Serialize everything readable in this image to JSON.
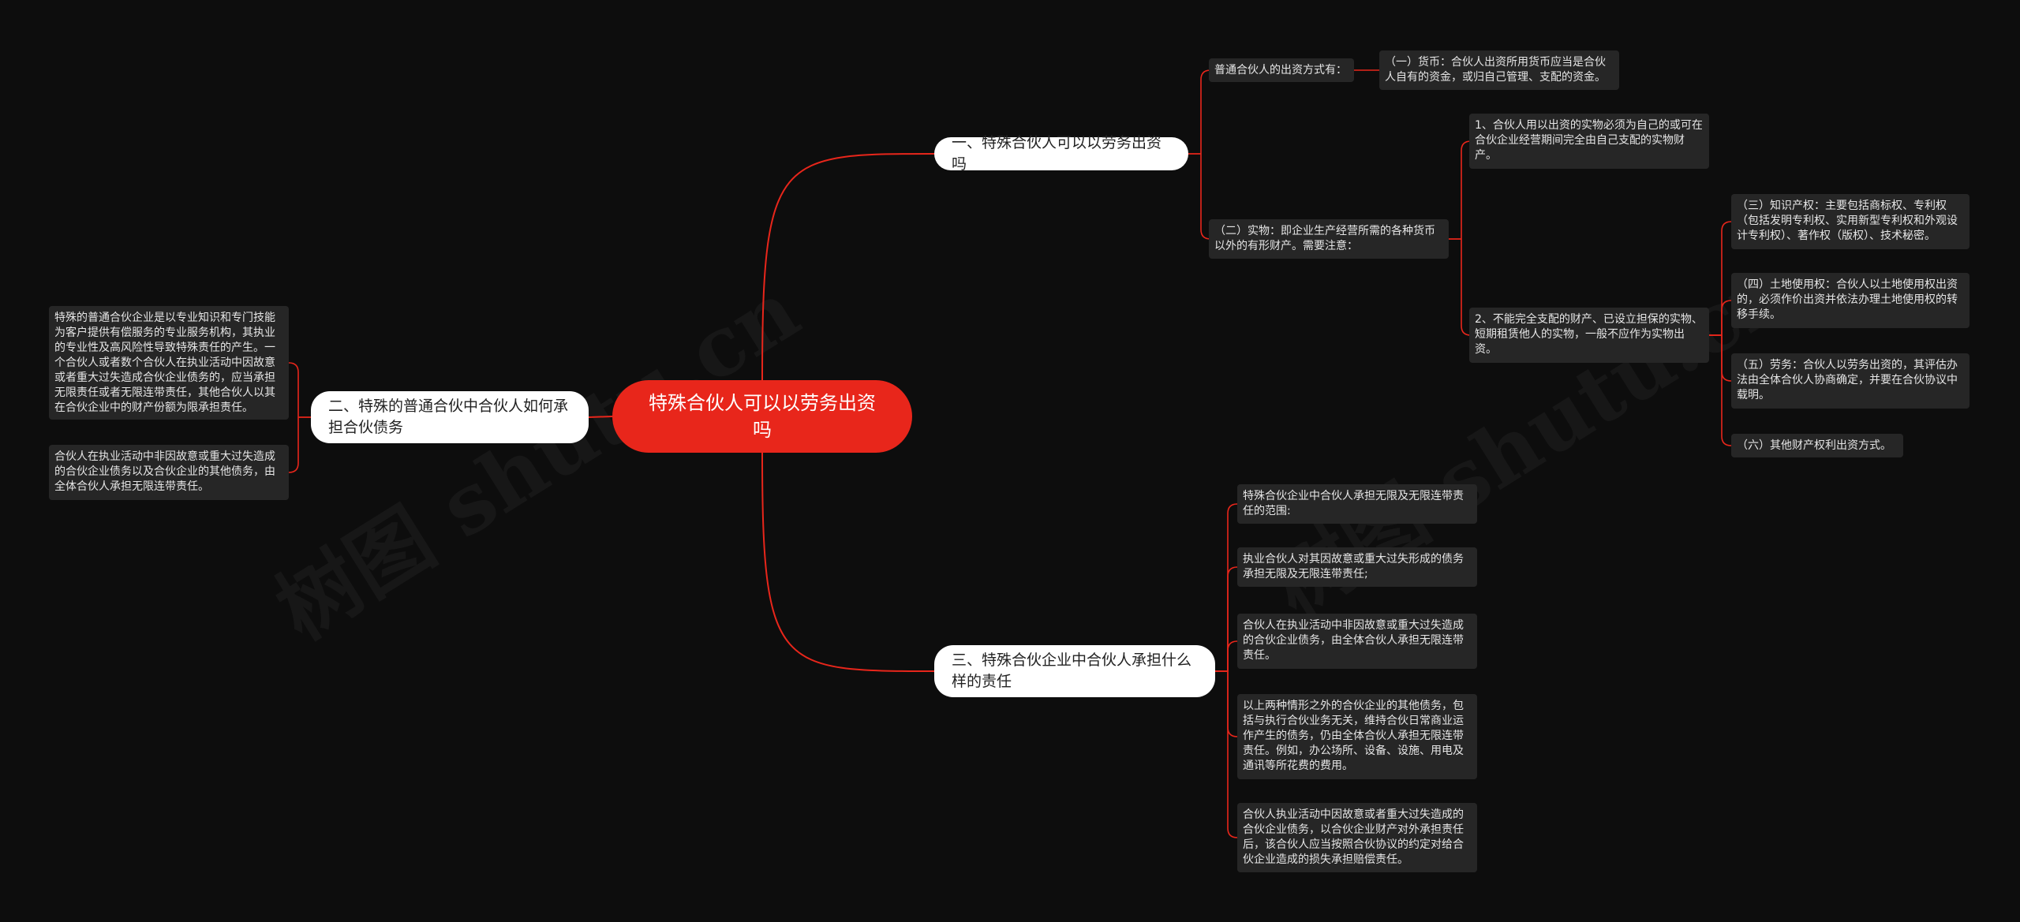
{
  "root": {
    "label": "特殊合伙人可以以劳务出资吗"
  },
  "branches": {
    "b1": {
      "label": "一、特殊合伙人可以以劳务出资吗"
    },
    "b2": {
      "label": "二、特殊的普通合伙中合伙人如何承担合伙债务"
    },
    "b3": {
      "label": "三、特殊合伙企业中合伙人承担什么样的责任"
    }
  },
  "leaves": {
    "b1_methods": "普通合伙人的出资方式有：",
    "b1_currency": "（一）货币：合伙人出资所用货币应当是合伙人自有的资金，或归自己管理、支配的资金。",
    "b1_goods": "（二）实物：即企业生产经营所需的各种货币以外的有形财产。需要注意：",
    "b1_goods_1": "1、合伙人用以出资的实物必须为自己的或可在合伙企业经营期间完全由自己支配的实物财产。",
    "b1_goods_2": "2、不能完全支配的财产、已设立担保的实物、短期租赁他人的实物，一般不应作为实物出资。",
    "b1_ip": "（三）知识产权：主要包括商标权、专利权（包括发明专利权、实用新型专利权和外观设计专利权）、著作权（版权）、技术秘密。",
    "b1_land": "（四）土地使用权：合伙人以土地使用权出资的，必须作价出资并依法办理土地使用权的转移手续。",
    "b1_labor": "（五）劳务：合伙人以劳务出资的，其评估办法由全体合伙人协商确定，并要在合伙协议中载明。",
    "b1_other": "（六）其他财产权利出资方式。",
    "b2_1": "特殊的普通合伙企业是以专业知识和专门技能为客户提供有偿服务的专业服务机构，其执业的专业性及高风险性导致特殊责任的产生。一个合伙人或者数个合伙人在执业活动中因故意或者重大过失造成合伙企业债务的，应当承担无限责任或者无限连带责任，其他合伙人以其在合伙企业中的财产份额为限承担责任。",
    "b2_2": "合伙人在执业活动中非因故意或重大过失造成的合伙企业债务以及合伙企业的其他债务，由全体合伙人承担无限连带责任。",
    "b3_1": "特殊合伙企业中合伙人承担无限及无限连带责任的范围:",
    "b3_2": "执业合伙人对其因故意或重大过失形成的债务承担无限及无限连带责任;",
    "b3_3": "合伙人在执业活动中非因故意或重大过失造成的合伙企业债务，由全体合伙人承担无限连带责任。",
    "b3_4": "以上两种情形之外的合伙企业的其他债务，包括与执行合伙业务无关，维持合伙日常商业运作产生的债务，仍由全体合伙人承担无限连带责任。例如，办公场所、设备、设施、用电及通讯等所花费的费用。",
    "b3_5": "合伙人执业活动中因故意或者重大过失造成的合伙企业债务，以合伙企业财产对外承担责任后，该合伙人应当按照合伙协议的约定对给合伙企业造成的损失承担赔偿责任。"
  },
  "colors": {
    "root": "#e8261b",
    "edge": "#e8261b",
    "branch": "#ffffff",
    "leaf": "#262626",
    "background": "#0d0d0d"
  }
}
